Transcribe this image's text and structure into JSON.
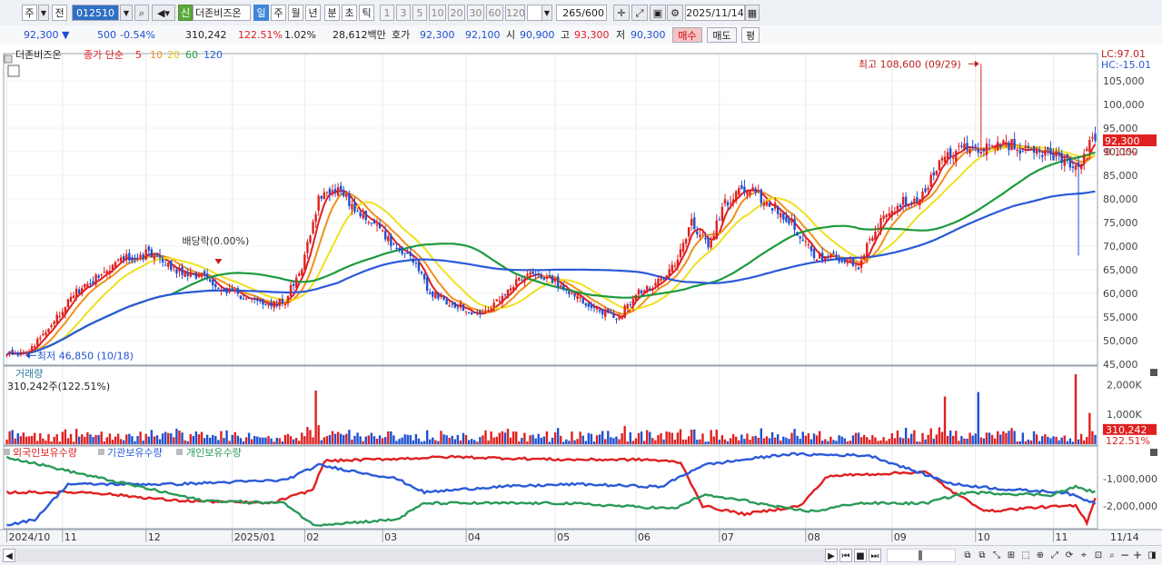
{
  "toolbar": {
    "market": "주",
    "prev": "전",
    "code": "012510",
    "badge": "신",
    "name": "더존비즈온",
    "periods": [
      "일",
      "주",
      "월",
      "년",
      "분",
      "초",
      "틱"
    ],
    "selected_period": "일",
    "intervals": [
      "1",
      "3",
      "5",
      "10",
      "20",
      "30",
      "60",
      "120"
    ],
    "count": "265",
    "count_total": "/600",
    "date": "2025/11/14"
  },
  "quote": {
    "price": "92,300",
    "change": "500",
    "change_pct": "-0.54%",
    "volume": "310,242",
    "volume_pct": "122.51%",
    "turnover_pct": "1.02%",
    "amount": "28,612백만",
    "bid_label": "호가",
    "ask": "92,300",
    "bid": "92,100",
    "open_label": "시",
    "open": "90,900",
    "high_label": "고",
    "high": "93,300",
    "low_label": "저",
    "low": "90,300",
    "buy": "매수",
    "sell": "매도",
    "avg": "평"
  },
  "colors": {
    "up": "#e02020",
    "down": "#2050d0",
    "ma5": "#e02020",
    "ma10": "#f0901e",
    "ma20": "#f0e020",
    "ma60": "#1c9b3c",
    "ma120": "#2a5ad8",
    "foreign": "#e02020",
    "inst": "#2a5ad8",
    "indiv": "#2a9a5a"
  },
  "chart_data": [
    {
      "type": "candlestick",
      "legend": {
        "name": "더존비즈온",
        "prefix": "종가 단순",
        "periods": [
          "5",
          "10",
          "20",
          "60",
          "120"
        ]
      },
      "ylim": [
        45000,
        110000
      ],
      "y_ticks": [
        "105,000",
        "100,000",
        "95,000",
        "90,000",
        "85,000",
        "80,000",
        "75,000",
        "70,000",
        "65,000",
        "60,000",
        "55,000",
        "50,000",
        "45,000"
      ],
      "right_top": [
        "LC:97.01",
        "HC:-15.01"
      ],
      "last_price": "92,300",
      "last_pct": "0.11%",
      "annotations": {
        "high": "최고 108,600 (09/29)",
        "low": "최저 46,850 (10/18)",
        "dividend": "배당락(0.00%)"
      },
      "anchors": [
        [
          0,
          47500
        ],
        [
          6,
          47000
        ],
        [
          14,
          52000
        ],
        [
          24,
          60000
        ],
        [
          34,
          64000
        ],
        [
          42,
          67500
        ],
        [
          52,
          68500
        ],
        [
          60,
          65000
        ],
        [
          72,
          63000
        ],
        [
          82,
          60000
        ],
        [
          92,
          57500
        ],
        [
          100,
          58500
        ],
        [
          106,
          66000
        ],
        [
          112,
          80000
        ],
        [
          118,
          82500
        ],
        [
          124,
          79000
        ],
        [
          132,
          74000
        ],
        [
          140,
          70000
        ],
        [
          146,
          67000
        ],
        [
          152,
          60000
        ],
        [
          158,
          58500
        ],
        [
          164,
          57000
        ],
        [
          170,
          55000
        ],
        [
          178,
          59000
        ],
        [
          186,
          64000
        ],
        [
          194,
          63000
        ],
        [
          204,
          60000
        ],
        [
          212,
          56500
        ],
        [
          220,
          55000
        ],
        [
          226,
          60000
        ],
        [
          234,
          62500
        ],
        [
          240,
          66000
        ],
        [
          246,
          75000
        ],
        [
          252,
          70000
        ],
        [
          258,
          79000
        ],
        [
          266,
          82500
        ],
        [
          274,
          79000
        ],
        [
          282,
          75000
        ],
        [
          290,
          68000
        ],
        [
          298,
          67500
        ],
        [
          306,
          65500
        ],
        [
          312,
          74000
        ],
        [
          320,
          79000
        ],
        [
          328,
          80500
        ],
        [
          336,
          88000
        ],
        [
          342,
          91000
        ],
        [
          350,
          90000
        ],
        [
          358,
          92000
        ],
        [
          366,
          90500
        ],
        [
          374,
          90000
        ],
        [
          380,
          88500
        ],
        [
          385,
          85500
        ],
        [
          388,
          91500
        ],
        [
          391,
          92300
        ]
      ],
      "high_index": 350,
      "high_value": 108600,
      "low_index": 6,
      "low_value": 46850,
      "dividend_index": 76
    },
    {
      "type": "bar",
      "title": "거래량",
      "subtitle": "310,242주(122.51%)",
      "y_ticks": [
        "2,000K",
        "1,000K"
      ],
      "ylim": [
        0,
        2500000
      ],
      "last_value": "310,242",
      "last_pct": "122.51%"
    },
    {
      "type": "line",
      "series": [
        {
          "name": "외국인보유수량",
          "key": "foreign",
          "anchors": [
            [
              0,
              -1500000
            ],
            [
              30,
              -1500000
            ],
            [
              60,
              -1800000
            ],
            [
              95,
              -1900000
            ],
            [
              110,
              -1400000
            ],
            [
              114,
              -350000
            ],
            [
              130,
              -300000
            ],
            [
              160,
              -200000
            ],
            [
              200,
              -300000
            ],
            [
              230,
              -300000
            ],
            [
              242,
              -400000
            ],
            [
              250,
              -2000000
            ],
            [
              265,
              -2300000
            ],
            [
              285,
              -2000000
            ],
            [
              295,
              -900000
            ],
            [
              330,
              -750000
            ],
            [
              340,
              -1500000
            ],
            [
              352,
              -2200000
            ],
            [
              370,
              -2050000
            ],
            [
              384,
              -2000000
            ],
            [
              388,
              -2600000
            ],
            [
              391,
              -1700000
            ]
          ]
        },
        {
          "name": "기관보유수량",
          "key": "inst",
          "anchors": [
            [
              0,
              -2700000
            ],
            [
              10,
              -2500000
            ],
            [
              22,
              -1200000
            ],
            [
              60,
              -1200000
            ],
            [
              100,
              -1050000
            ],
            [
              112,
              -500000
            ],
            [
              140,
              -1000000
            ],
            [
              150,
              -1500000
            ],
            [
              175,
              -1300000
            ],
            [
              205,
              -1200000
            ],
            [
              235,
              -1300000
            ],
            [
              250,
              -500000
            ],
            [
              280,
              -100000
            ],
            [
              310,
              -150000
            ],
            [
              340,
              -1200000
            ],
            [
              360,
              -1400000
            ],
            [
              380,
              -1500000
            ],
            [
              391,
              -1900000
            ]
          ]
        },
        {
          "name": "개인보유수량",
          "key": "indiv",
          "anchors": [
            [
              0,
              -200000
            ],
            [
              30,
              -900000
            ],
            [
              70,
              -1800000
            ],
            [
              100,
              -1900000
            ],
            [
              110,
              -2700000
            ],
            [
              140,
              -2500000
            ],
            [
              150,
              -1900000
            ],
            [
              200,
              -1900000
            ],
            [
              240,
              -2100000
            ],
            [
              250,
              -1600000
            ],
            [
              265,
              -1800000
            ],
            [
              280,
              -2100000
            ],
            [
              290,
              -2200000
            ],
            [
              305,
              -1900000
            ],
            [
              330,
              -1900000
            ],
            [
              345,
              -1500000
            ],
            [
              375,
              -1600000
            ],
            [
              384,
              -1300000
            ],
            [
              391,
              -1500000
            ]
          ]
        }
      ],
      "y_ticks": [
        "-1,000,000",
        "-2,000,000"
      ],
      "ylim": [
        -2800000,
        0
      ]
    }
  ],
  "x_labels": {
    "labels": [
      "2024/10",
      "11",
      "12",
      "2025/01",
      "02",
      "03",
      "04",
      "05",
      "06",
      "07",
      "08",
      "09",
      "10",
      "11"
    ],
    "indices": [
      0,
      20,
      50,
      81,
      107,
      135,
      165,
      197,
      226,
      256,
      287,
      318,
      348,
      376
    ],
    "right_date": "11/14"
  }
}
